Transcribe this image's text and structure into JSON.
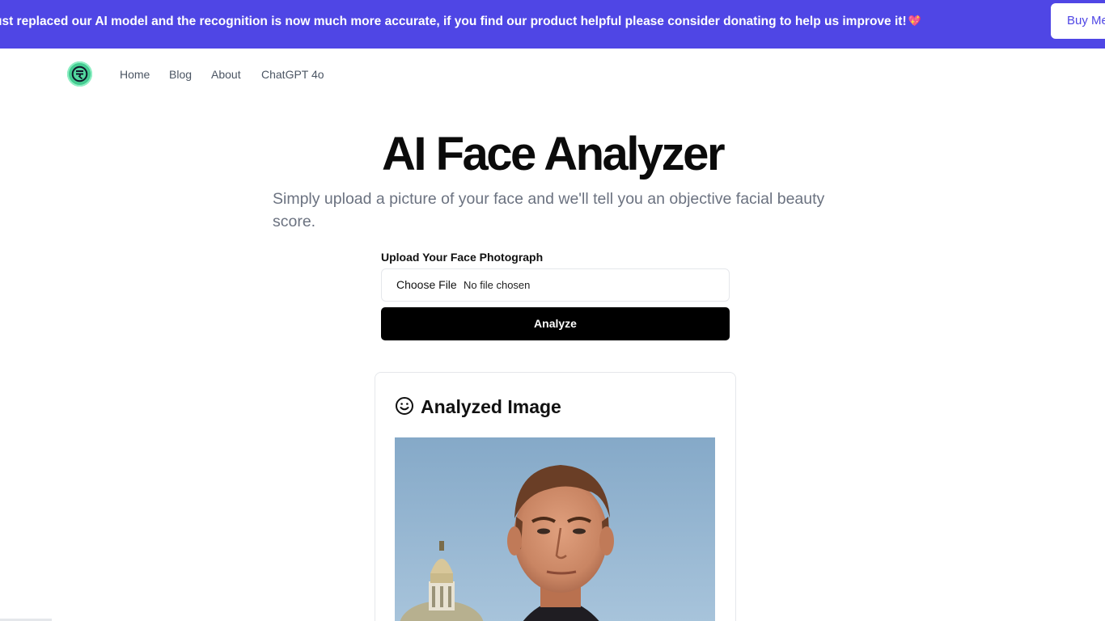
{
  "banner": {
    "message": "ust replaced our AI model and the recognition is now much more accurate, if you find our product helpful please consider donating to help us improve it!",
    "heart_icon": "💖",
    "button_label": "Buy Me",
    "background": "#4f46e5"
  },
  "nav": {
    "logo_icon": "logo-icon",
    "links": [
      "Home",
      "Blog",
      "About",
      "ChatGPT 4o"
    ]
  },
  "hero": {
    "title": "AI Face Analyzer",
    "subtitle": "Simply upload a picture of your face and we'll tell you an objective facial beauty score."
  },
  "form": {
    "upload_label": "Upload Your Face Photograph",
    "choose_file_label": "Choose File",
    "file_status": "No file chosen",
    "analyze_label": "Analyze"
  },
  "result": {
    "icon": "smile-icon",
    "title": "Analyzed Image"
  }
}
